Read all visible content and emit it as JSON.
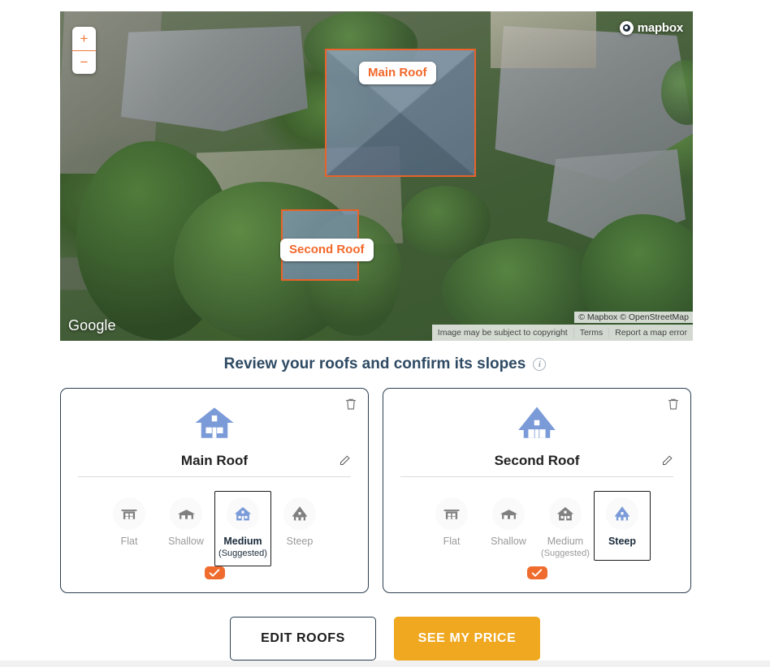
{
  "map": {
    "zoom_in_label": "+",
    "zoom_out_label": "−",
    "mapbox_logo_text": "mapbox",
    "google_logo_text": "Google",
    "mapbox_attribution": "© Mapbox © OpenStreetMap",
    "google_attribution": {
      "copyright": "Image may be subject to copyright",
      "terms": "Terms",
      "report": "Report a map error"
    },
    "roof_labels": [
      {
        "name": "Main Roof"
      },
      {
        "name": "Second Roof"
      }
    ],
    "polygon_stroke_color": "#e8622a",
    "polygon_fill_color": "rgba(110,135,170,0.55)"
  },
  "heading": {
    "title": "Review your roofs and confirm its slopes",
    "info_icon": "info-icon",
    "color": "#2e4a63"
  },
  "cards": [
    {
      "title": "Main Roof",
      "house_icon": "house-medium-icon",
      "delete_icon": "trash-icon",
      "edit_icon": "pencil-icon",
      "confirm_icon": "check-icon",
      "selected_slope": "Medium",
      "slopes": [
        {
          "label": "Flat",
          "icon": "house-flat-icon",
          "suggested": false,
          "selected": false,
          "note": ""
        },
        {
          "label": "Shallow",
          "icon": "house-shallow-icon",
          "suggested": false,
          "selected": false,
          "note": ""
        },
        {
          "label": "Medium",
          "icon": "house-medium-icon",
          "suggested": true,
          "selected": true,
          "note": "(Suggested)"
        },
        {
          "label": "Steep",
          "icon": "house-steep-icon",
          "suggested": false,
          "selected": false,
          "note": ""
        }
      ]
    },
    {
      "title": "Second Roof",
      "house_icon": "house-steep-icon",
      "delete_icon": "trash-icon",
      "edit_icon": "pencil-icon",
      "confirm_icon": "check-icon",
      "selected_slope": "Steep",
      "slopes": [
        {
          "label": "Flat",
          "icon": "house-flat-icon",
          "suggested": false,
          "selected": false,
          "note": ""
        },
        {
          "label": "Shallow",
          "icon": "house-shallow-icon",
          "suggested": false,
          "selected": false,
          "note": ""
        },
        {
          "label": "Medium",
          "icon": "house-medium-icon",
          "suggested": true,
          "selected": false,
          "note": "(Suggested)"
        },
        {
          "label": "Steep",
          "icon": "house-steep-icon",
          "suggested": false,
          "selected": true,
          "note": ""
        }
      ]
    }
  ],
  "actions": {
    "edit_label": "EDIT ROOFS",
    "price_label": "SEE MY PRICE",
    "price_color": "#efa81f",
    "accent_orange": "#ef6c2e",
    "house_blue": "#7b9bd8"
  }
}
